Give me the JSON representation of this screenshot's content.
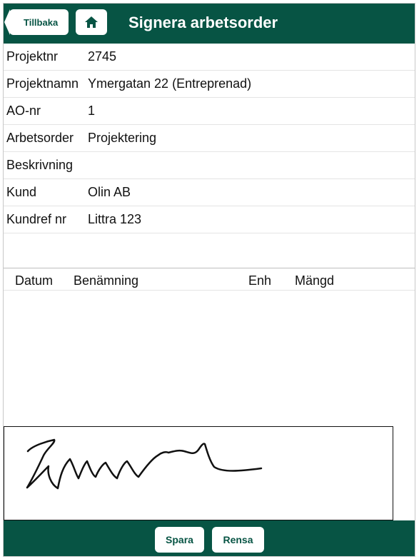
{
  "header": {
    "back_label": "Tillbaka",
    "title": "Signera arbetsorder"
  },
  "info": [
    {
      "label": "Projektnr",
      "value": "2745"
    },
    {
      "label": "Projektnamn",
      "value": "Ymergatan 22 (Entreprenad)"
    },
    {
      "label": "AO-nr",
      "value": "1"
    },
    {
      "label": "Arbetsorder",
      "value": "Projektering"
    },
    {
      "label": "Beskrivning",
      "value": ""
    },
    {
      "label": "Kund",
      "value": "Olin AB"
    },
    {
      "label": "Kundref nr",
      "value": "Littra 123"
    }
  ],
  "table": {
    "columns": [
      "Datum",
      "Benämning",
      "Enh",
      "Mängd"
    ],
    "rows": []
  },
  "footer": {
    "save_label": "Spara",
    "clear_label": "Rensa"
  },
  "colors": {
    "brand": "#075444"
  }
}
